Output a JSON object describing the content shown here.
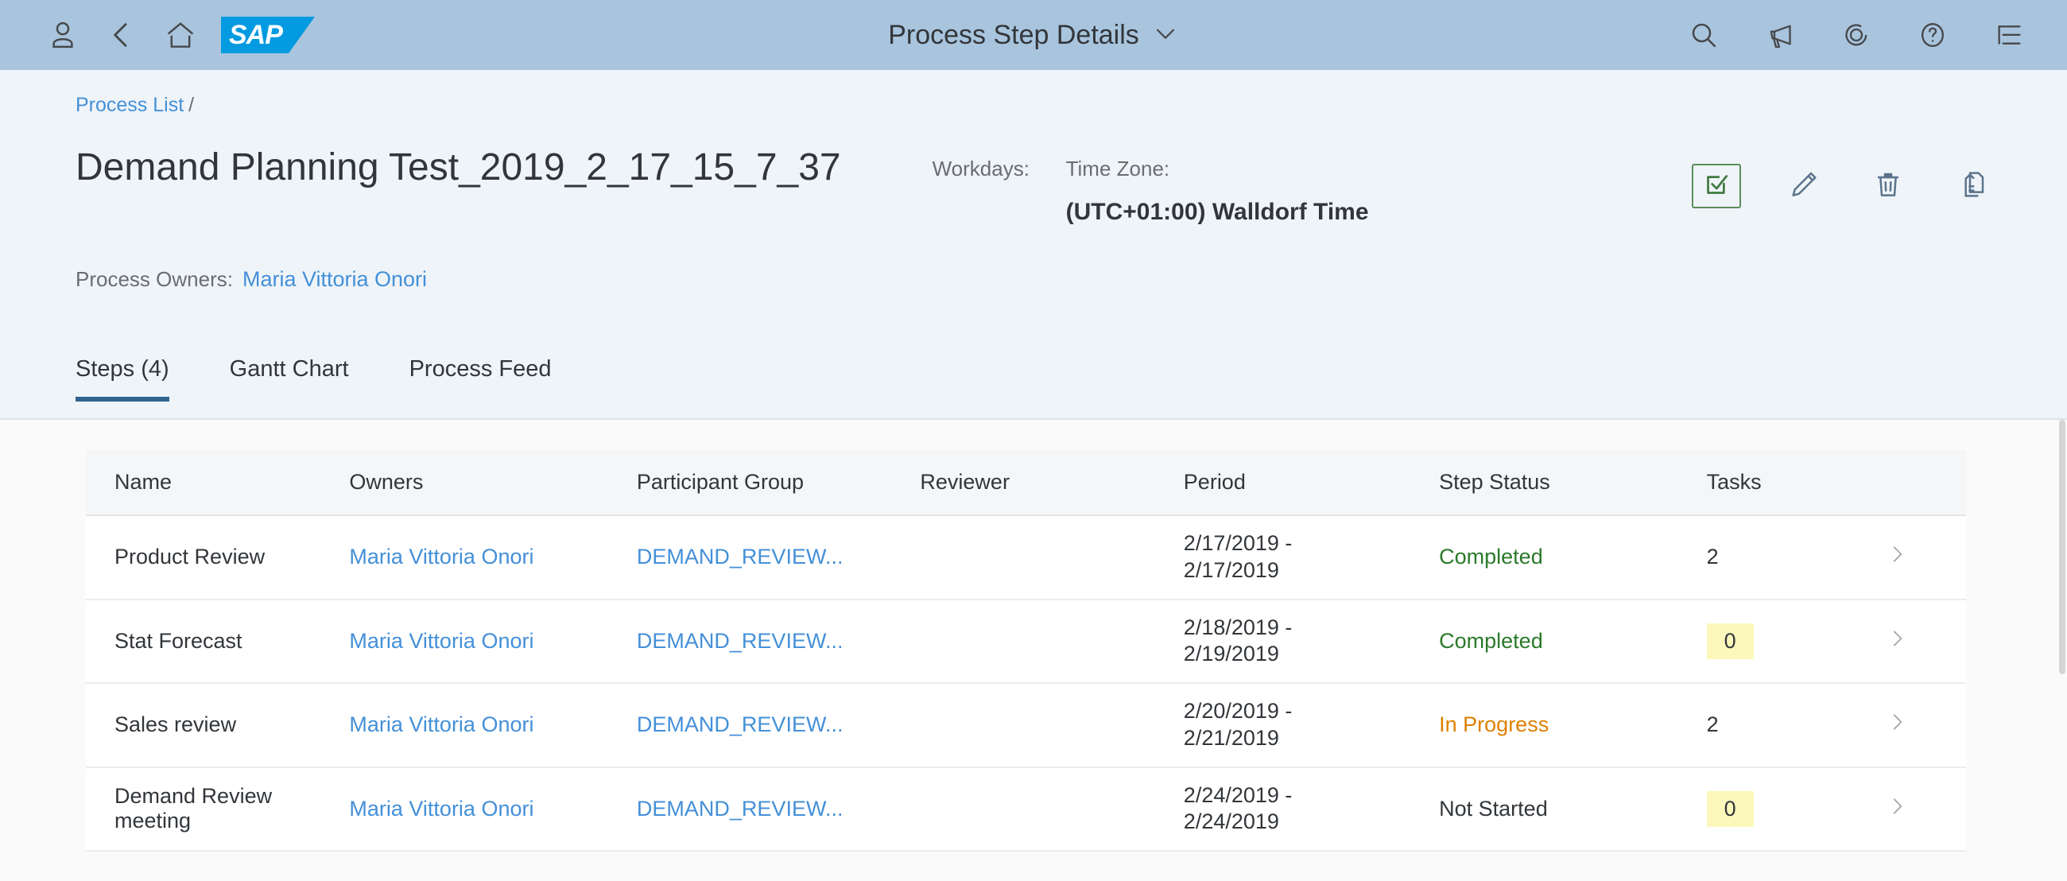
{
  "shellbar": {
    "icons_left": [
      {
        "name": "user-icon",
        "label": "User"
      },
      {
        "name": "back-icon",
        "label": "Back"
      },
      {
        "name": "home-icon",
        "label": "Home"
      }
    ],
    "logo_text": "SAP",
    "title": "Process Step Details",
    "title_chevron": "chevron-down-icon",
    "icons_right": [
      {
        "name": "search-icon",
        "label": "Search"
      },
      {
        "name": "megaphone-icon",
        "label": "Announcements"
      },
      {
        "name": "copilot-icon",
        "label": "Co-Pilot"
      },
      {
        "name": "help-icon",
        "label": "Help"
      },
      {
        "name": "overflow-list-icon",
        "label": "Options"
      }
    ]
  },
  "header": {
    "breadcrumb": {
      "link": "Process List",
      "separator": "/"
    },
    "title": "Demand Planning Test_2019_2_17_15_7_37",
    "facets": [
      {
        "label": "Workdays:",
        "value": ""
      },
      {
        "label": "Time Zone:",
        "value": "(UTC+01:00) Walldorf Time"
      }
    ],
    "owners_label": "Process Owners:",
    "owners_value": "Maria Vittoria Onori",
    "actions": [
      {
        "name": "complete-button",
        "icon": "checkbox-checked-icon",
        "label": "Complete"
      },
      {
        "name": "edit-button",
        "icon": "pencil-icon",
        "label": "Edit"
      },
      {
        "name": "delete-button",
        "icon": "trash-icon",
        "label": "Delete"
      },
      {
        "name": "copy-button",
        "icon": "copy-icon",
        "label": "Copy"
      }
    ]
  },
  "tabs": [
    {
      "label": "Steps (4)",
      "active": true
    },
    {
      "label": "Gantt Chart",
      "active": false
    },
    {
      "label": "Process Feed",
      "active": false
    }
  ],
  "table": {
    "columns": [
      "Name",
      "Owners",
      "Participant Group",
      "Reviewer",
      "Period",
      "Step Status",
      "Tasks",
      ""
    ],
    "rows": [
      {
        "name": "Product Review",
        "owners": "Maria Vittoria Onori",
        "participant_group": "DEMAND_REVIEW...",
        "reviewer": "",
        "period": "2/17/2019 -\n2/17/2019",
        "status": "Completed",
        "status_kind": "completed",
        "tasks": "2",
        "tasks_highlighted": false,
        "nav": "›"
      },
      {
        "name": "Stat Forecast",
        "owners": "Maria Vittoria Onori",
        "participant_group": "DEMAND_REVIEW...",
        "reviewer": "",
        "period": "2/18/2019 -\n2/19/2019",
        "status": "Completed",
        "status_kind": "completed",
        "tasks": "0",
        "tasks_highlighted": true,
        "nav": "›"
      },
      {
        "name": "Sales review",
        "owners": "Maria Vittoria Onori",
        "participant_group": "DEMAND_REVIEW...",
        "reviewer": "",
        "period": "2/20/2019 -\n2/21/2019",
        "status": "In Progress",
        "status_kind": "inprogress",
        "tasks": "2",
        "tasks_highlighted": false,
        "nav": "›"
      },
      {
        "name": "Demand Review meeting",
        "owners": "Maria Vittoria Onori",
        "participant_group": "DEMAND_REVIEW...",
        "reviewer": "",
        "period": "2/24/2019 -\n2/24/2019",
        "status": "Not Started",
        "status_kind": "notstarted",
        "tasks": "0",
        "tasks_highlighted": true,
        "nav": "›"
      }
    ]
  },
  "colors": {
    "shellbar_bg": "#a9c4dd",
    "header_bg": "#eff4f9",
    "link": "#4490d8",
    "sap_blue": "#029ae0",
    "status_completed": "#2a7a2a",
    "status_inprogress": "#df8000",
    "tab_underline": "#2f6490",
    "task_highlight": "#fcf8bc",
    "complete_border": "#5b8c5a"
  }
}
